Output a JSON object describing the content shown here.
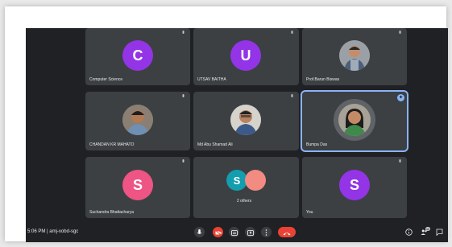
{
  "participants": [
    {
      "name": "Computer Science",
      "initial": "C",
      "color": "#9334e6",
      "kind": "initial"
    },
    {
      "name": "UTSAV BAITHA",
      "initial": "U",
      "color": "#9334e6",
      "kind": "initial"
    },
    {
      "name": "Prof.Barun Biswas",
      "kind": "photo"
    },
    {
      "name": "CHANDAN KR MAHATO",
      "kind": "photo"
    },
    {
      "name": "Md Abu Shamad Ali",
      "kind": "photo"
    },
    {
      "name": "Bumpa Das",
      "kind": "photo",
      "active": true
    },
    {
      "name": "Suchandra Bhattacharya",
      "initial": "S",
      "color": "#ee5584",
      "kind": "initial"
    },
    {
      "name": "2 others",
      "kind": "group",
      "group_initial": "S",
      "group_colors": [
        "#129eaf",
        "#f28b82"
      ]
    },
    {
      "name": "You",
      "initial": "S",
      "color": "#9334e6",
      "kind": "initial"
    }
  ],
  "bottom_bar": {
    "time": "5:06 PM",
    "separator": "|",
    "meeting_code": "amj-xobd-sgc"
  },
  "icons": {
    "mic": "mic-icon",
    "camera_off": "camera-off-icon",
    "captions": "captions-icon",
    "present": "present-icon",
    "more": "more-options-icon",
    "end_call": "end-call-icon",
    "info": "info-icon",
    "people": "people-icon",
    "chat": "chat-icon"
  },
  "people_count": "11",
  "colors": {
    "background": "#202124",
    "tile": "#3c4043",
    "active_outline": "#8ab4f8",
    "end_call": "#ea4335"
  }
}
